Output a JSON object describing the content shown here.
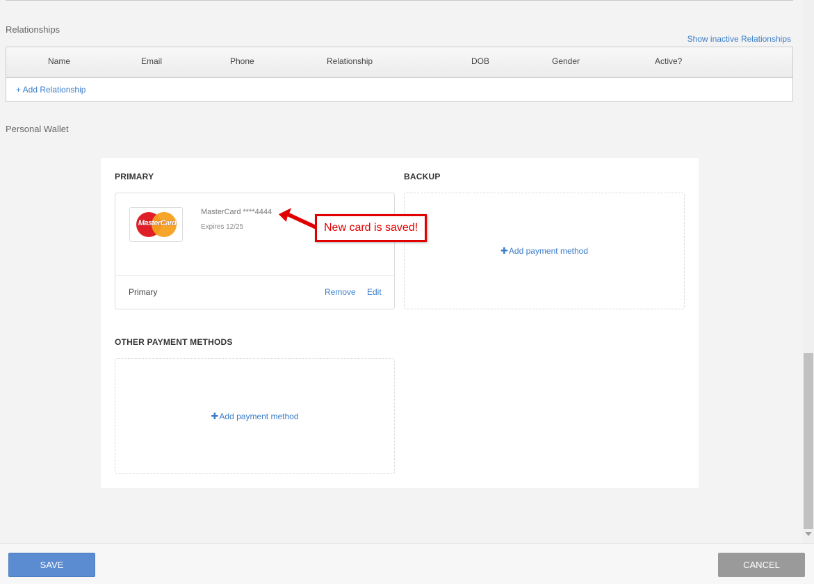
{
  "relationships": {
    "title": "Relationships",
    "show_inactive": "Show inactive Relationships",
    "columns": [
      "Name",
      "Email",
      "Phone",
      "Relationship",
      "DOB",
      "Gender",
      "Active?"
    ],
    "add_label": "+ Add Relationship"
  },
  "wallet": {
    "title": "Personal Wallet",
    "primary_label": "PRIMARY",
    "backup_label": "BACKUP",
    "other_label": "OTHER PAYMENT METHODS",
    "card": {
      "logo_text": "MasterCard",
      "name": "MasterCard ****4444",
      "expires": "Expires 12/25",
      "status": "Primary",
      "remove": "Remove",
      "edit": "Edit"
    },
    "add_payment": "Add payment method",
    "plus_glyph": "✚"
  },
  "callout": {
    "text": "New card is saved!",
    "color": "#e00000"
  },
  "footer": {
    "save": "SAVE",
    "cancel": "CANCEL"
  }
}
